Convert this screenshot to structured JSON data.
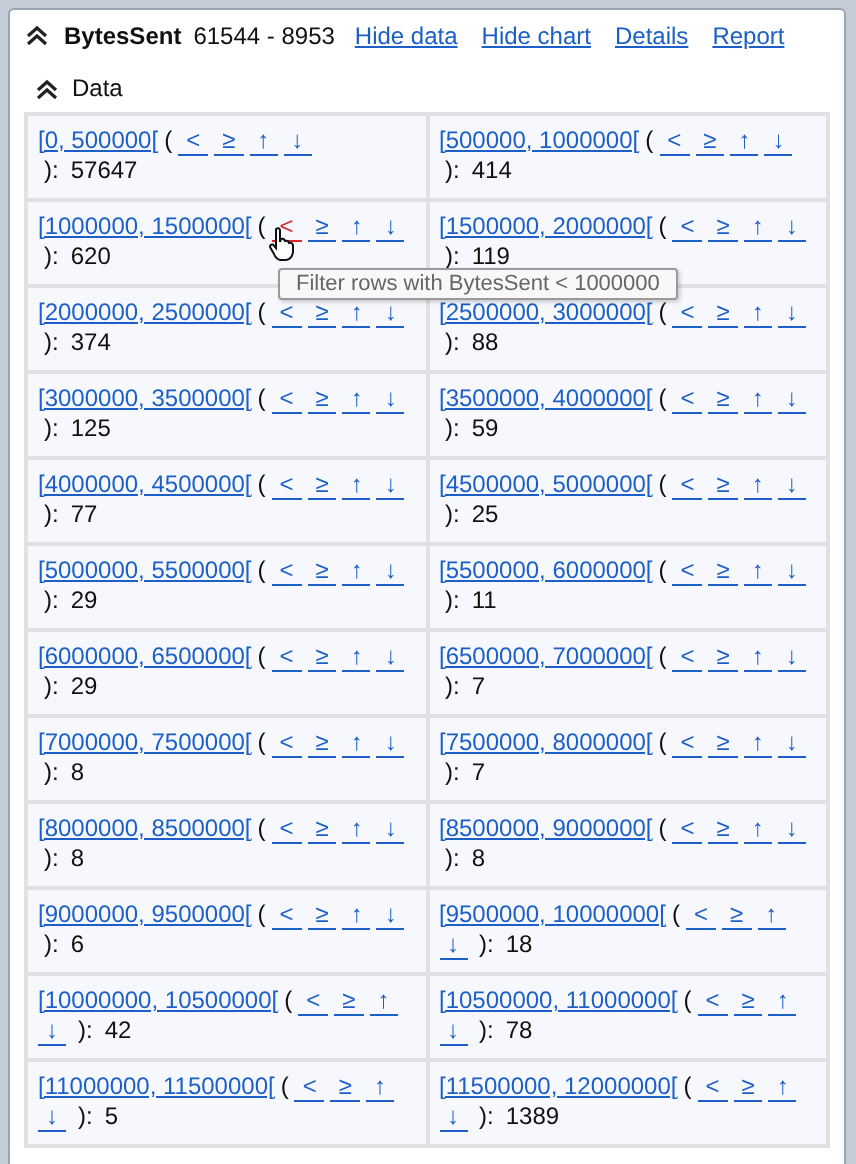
{
  "header": {
    "title": "BytesSent",
    "stats": "61544 - 8953",
    "links": [
      "Hide data",
      "Hide chart",
      "Details",
      "Report"
    ]
  },
  "section": {
    "title": "Data"
  },
  "cells": [
    {
      "range": "[0, 500000[",
      "open": "(",
      "close": "):",
      "count": "57647",
      "links": [
        {
          "label": "<",
          "hovered": false
        },
        {
          "label": "≥",
          "hovered": false
        },
        {
          "label": "↑",
          "hovered": false
        },
        {
          "label": "↓",
          "hovered": false
        }
      ]
    },
    {
      "range": "[500000, 1000000[",
      "open": "(",
      "close": "):",
      "count": "414",
      "links": [
        {
          "label": "<",
          "hovered": false
        },
        {
          "label": "≥",
          "hovered": false
        },
        {
          "label": "↑",
          "hovered": false
        },
        {
          "label": "↓",
          "hovered": false
        }
      ]
    },
    {
      "range": "[1000000, 1500000[",
      "open": "(",
      "close": "):",
      "count": "620",
      "links": [
        {
          "label": "<",
          "hovered": true
        },
        {
          "label": "≥",
          "hovered": false
        },
        {
          "label": "↑",
          "hovered": false
        },
        {
          "label": "↓",
          "hovered": false
        }
      ]
    },
    {
      "range": "[1500000, 2000000[",
      "open": "(",
      "close": "):",
      "count": "119",
      "links": [
        {
          "label": "<",
          "hovered": false
        },
        {
          "label": "≥",
          "hovered": false
        },
        {
          "label": "↑",
          "hovered": false
        },
        {
          "label": "↓",
          "hovered": false
        }
      ]
    },
    {
      "range": "[2000000, 2500000[",
      "open": "(",
      "close": "):",
      "count": "374",
      "links": [
        {
          "label": "<",
          "hovered": false
        },
        {
          "label": "≥",
          "hovered": false
        },
        {
          "label": "↑",
          "hovered": false
        },
        {
          "label": "↓",
          "hovered": false
        }
      ]
    },
    {
      "range": "[2500000, 3000000[",
      "open": "(",
      "close": "):",
      "count": "88",
      "links": [
        {
          "label": "<",
          "hovered": false
        },
        {
          "label": "≥",
          "hovered": false
        },
        {
          "label": "↑",
          "hovered": false
        },
        {
          "label": "↓",
          "hovered": false
        }
      ]
    },
    {
      "range": "[3000000, 3500000[",
      "open": "(",
      "close": "):",
      "count": "125",
      "links": [
        {
          "label": "<",
          "hovered": false
        },
        {
          "label": "≥",
          "hovered": false
        },
        {
          "label": "↑",
          "hovered": false
        },
        {
          "label": "↓",
          "hovered": false
        }
      ]
    },
    {
      "range": "[3500000, 4000000[",
      "open": "(",
      "close": "):",
      "count": "59",
      "links": [
        {
          "label": "<",
          "hovered": false
        },
        {
          "label": "≥",
          "hovered": false
        },
        {
          "label": "↑",
          "hovered": false
        },
        {
          "label": "↓",
          "hovered": false
        }
      ]
    },
    {
      "range": "[4000000, 4500000[",
      "open": "(",
      "close": "):",
      "count": "77",
      "links": [
        {
          "label": "<",
          "hovered": false
        },
        {
          "label": "≥",
          "hovered": false
        },
        {
          "label": "↑",
          "hovered": false
        },
        {
          "label": "↓",
          "hovered": false
        }
      ]
    },
    {
      "range": "[4500000, 5000000[",
      "open": "(",
      "close": "):",
      "count": "25",
      "links": [
        {
          "label": "<",
          "hovered": false
        },
        {
          "label": "≥",
          "hovered": false
        },
        {
          "label": "↑",
          "hovered": false
        },
        {
          "label": "↓",
          "hovered": false
        }
      ]
    },
    {
      "range": "[5000000, 5500000[",
      "open": "(",
      "close": "):",
      "count": "29",
      "links": [
        {
          "label": "<",
          "hovered": false
        },
        {
          "label": "≥",
          "hovered": false
        },
        {
          "label": "↑",
          "hovered": false
        },
        {
          "label": "↓",
          "hovered": false
        }
      ]
    },
    {
      "range": "[5500000, 6000000[",
      "open": "(",
      "close": "):",
      "count": "11",
      "links": [
        {
          "label": "<",
          "hovered": false
        },
        {
          "label": "≥",
          "hovered": false
        },
        {
          "label": "↑",
          "hovered": false
        },
        {
          "label": "↓",
          "hovered": false
        }
      ]
    },
    {
      "range": "[6000000, 6500000[",
      "open": "(",
      "close": "):",
      "count": "29",
      "links": [
        {
          "label": "<",
          "hovered": false
        },
        {
          "label": "≥",
          "hovered": false
        },
        {
          "label": "↑",
          "hovered": false
        },
        {
          "label": "↓",
          "hovered": false
        }
      ]
    },
    {
      "range": "[6500000, 7000000[",
      "open": "(",
      "close": "):",
      "count": "7",
      "links": [
        {
          "label": "<",
          "hovered": false
        },
        {
          "label": "≥",
          "hovered": false
        },
        {
          "label": "↑",
          "hovered": false
        },
        {
          "label": "↓",
          "hovered": false
        }
      ]
    },
    {
      "range": "[7000000, 7500000[",
      "open": "(",
      "close": "):",
      "count": "8",
      "links": [
        {
          "label": "<",
          "hovered": false
        },
        {
          "label": "≥",
          "hovered": false
        },
        {
          "label": "↑",
          "hovered": false
        },
        {
          "label": "↓",
          "hovered": false
        }
      ]
    },
    {
      "range": "[7500000, 8000000[",
      "open": "(",
      "close": "):",
      "count": "7",
      "links": [
        {
          "label": "<",
          "hovered": false
        },
        {
          "label": "≥",
          "hovered": false
        },
        {
          "label": "↑",
          "hovered": false
        },
        {
          "label": "↓",
          "hovered": false
        }
      ]
    },
    {
      "range": "[8000000, 8500000[",
      "open": "(",
      "close": "):",
      "count": "8",
      "links": [
        {
          "label": "<",
          "hovered": false
        },
        {
          "label": "≥",
          "hovered": false
        },
        {
          "label": "↑",
          "hovered": false
        },
        {
          "label": "↓",
          "hovered": false
        }
      ]
    },
    {
      "range": "[8500000, 9000000[",
      "open": "(",
      "close": "):",
      "count": "8",
      "links": [
        {
          "label": "<",
          "hovered": false
        },
        {
          "label": "≥",
          "hovered": false
        },
        {
          "label": "↑",
          "hovered": false
        },
        {
          "label": "↓",
          "hovered": false
        }
      ]
    },
    {
      "range": "[9000000, 9500000[",
      "open": "(",
      "close": "):",
      "count": "6",
      "links": [
        {
          "label": "<",
          "hovered": false
        },
        {
          "label": "≥",
          "hovered": false
        },
        {
          "label": "↑",
          "hovered": false
        },
        {
          "label": "↓",
          "hovered": false
        }
      ]
    },
    {
      "range": "[9500000, 10000000[",
      "open": "(",
      "close": "):",
      "count": "18",
      "links": [
        {
          "label": "<",
          "hovered": false
        },
        {
          "label": "≥",
          "hovered": false
        },
        {
          "label": "↑",
          "hovered": false
        },
        {
          "label": "↓",
          "hovered": false
        }
      ]
    },
    {
      "range": "[10000000, 10500000[",
      "open": "(",
      "close": "):",
      "count": "42",
      "links": [
        {
          "label": "<",
          "hovered": false
        },
        {
          "label": "≥",
          "hovered": false
        },
        {
          "label": "↑",
          "hovered": false
        },
        {
          "label": "↓",
          "hovered": false
        }
      ]
    },
    {
      "range": "[10500000, 11000000[",
      "open": "(",
      "close": "):",
      "count": "78",
      "links": [
        {
          "label": "<",
          "hovered": false
        },
        {
          "label": "≥",
          "hovered": false
        },
        {
          "label": "↑",
          "hovered": false
        },
        {
          "label": "↓",
          "hovered": false
        }
      ]
    },
    {
      "range": "[11000000, 11500000[",
      "open": "(",
      "close": "):",
      "count": "5",
      "links": [
        {
          "label": "<",
          "hovered": false
        },
        {
          "label": "≥",
          "hovered": false
        },
        {
          "label": "↑",
          "hovered": false
        },
        {
          "label": "↓",
          "hovered": false
        }
      ]
    },
    {
      "range": "[11500000, 12000000[",
      "open": "(",
      "close": "):",
      "count": "1389",
      "links": [
        {
          "label": "<",
          "hovered": false
        },
        {
          "label": "≥",
          "hovered": false
        },
        {
          "label": "↑",
          "hovered": false
        },
        {
          "label": "↓",
          "hovered": false
        }
      ]
    }
  ],
  "tooltip": {
    "text": "Filter rows with BytesSent < 1000000"
  }
}
